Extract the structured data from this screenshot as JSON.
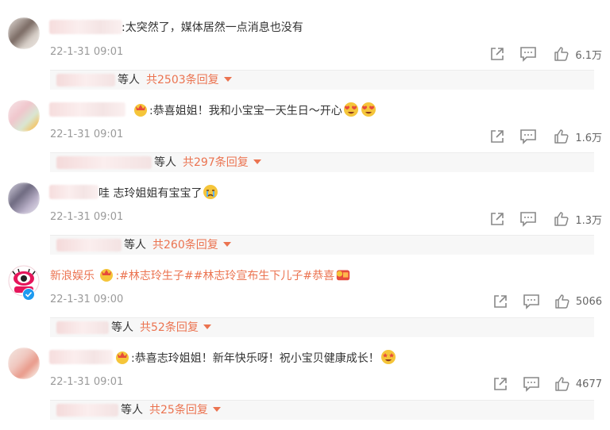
{
  "comments": [
    {
      "text": ":太突然了，媒体居然一点消息也没有",
      "time": "22-1-31 09:01",
      "likes": "6.1万",
      "reply_who": "等人",
      "reply_count": "共2503条回复"
    },
    {
      "text": ":恭喜姐姐！我和小宝宝一天生日～开心",
      "time": "22-1-31 09:01",
      "likes": "1.6万",
      "reply_who": "等人",
      "reply_count": "共297条回复"
    },
    {
      "text": "哇 志玲姐姐有宝宝了",
      "time": "22-1-31 09:01",
      "likes": "1.3万",
      "reply_who": "等人",
      "reply_count": "共260条回复"
    },
    {
      "author": "新浪娱乐",
      "text": ":#林志玲生子##林志玲宣布生下儿子#恭喜",
      "time": "22-1-31 09:00",
      "likes": "5066",
      "reply_who": "等人",
      "reply_count": "共52条回复"
    },
    {
      "text": ":恭喜志玲姐姐！新年快乐呀！祝小宝贝健康成长！",
      "time": "22-1-31 09:01",
      "likes": "4677",
      "reply_who": "等人",
      "reply_count": "共25条回复"
    }
  ],
  "icons": {
    "share": "share-icon",
    "comment": "comment-icon",
    "like": "like-icon"
  },
  "colors": {
    "accent": "#eb7350",
    "meta": "#9a9a9a"
  }
}
